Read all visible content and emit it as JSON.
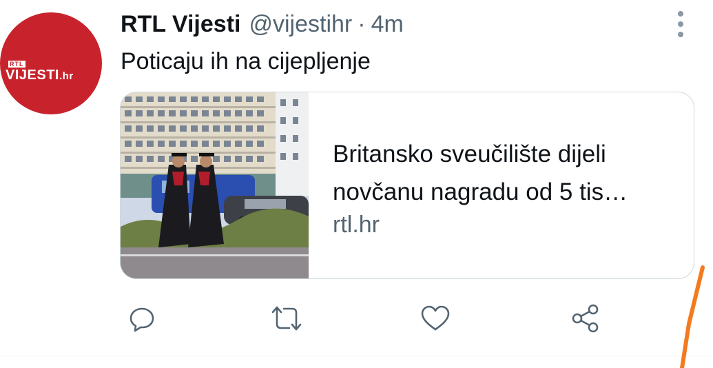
{
  "tweet": {
    "author_name": "RTL Vijesti",
    "author_handle": "@vijestihr",
    "separator": "·",
    "time": "4m",
    "text": "Poticaju ih na cijepljenje",
    "avatar": {
      "logo_badge": "RTL",
      "logo_main": "VIJESTI",
      "logo_suffix": ".hr",
      "color": "#c8232c"
    }
  },
  "card": {
    "title": "Britansko sveučilište dijeli novčanu nagradu od 5 tis…",
    "domain": "rtl.hr"
  },
  "actions": {
    "icons": [
      "reply-icon",
      "retweet-icon",
      "like-icon",
      "share-icon"
    ]
  },
  "colors": {
    "text_primary": "#0f1419",
    "text_secondary": "#536471",
    "border": "#cfd9de",
    "annotation": "#f47a20"
  }
}
